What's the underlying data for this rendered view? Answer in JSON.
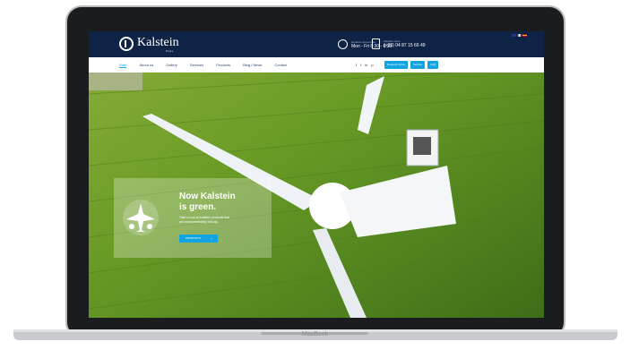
{
  "device": {
    "brand_label": "MacBook"
  },
  "header": {
    "logo_text": "Kalstein",
    "logo_sub": "France",
    "hours_label": "Horaires d'ouverture",
    "hours_value": "Mon - Fri 8:30 - 6:30",
    "phone_label": "Appelez-nous",
    "phone_value": "(+33) 04 87 15 66 49"
  },
  "nav": {
    "items": [
      "Start",
      "About us",
      "Gallery",
      "Services",
      "Products",
      "Blog / News",
      "Contact"
    ],
    "active_index": 0,
    "social": [
      "f",
      "t",
      "in",
      "p"
    ],
    "buttons": [
      "Request Quote",
      "Section",
      "FAQ"
    ]
  },
  "hero": {
    "title_line1": "Now Kalstein",
    "title_line2": "is green.",
    "text": "Take a look at Kalstein products that are environmentally friendly.",
    "button_label": "PRODUCTS",
    "button_arrow": "›"
  },
  "colors": {
    "header_bg": "#0f2347",
    "accent": "#12a4e0",
    "grass": "#5a8a24"
  }
}
